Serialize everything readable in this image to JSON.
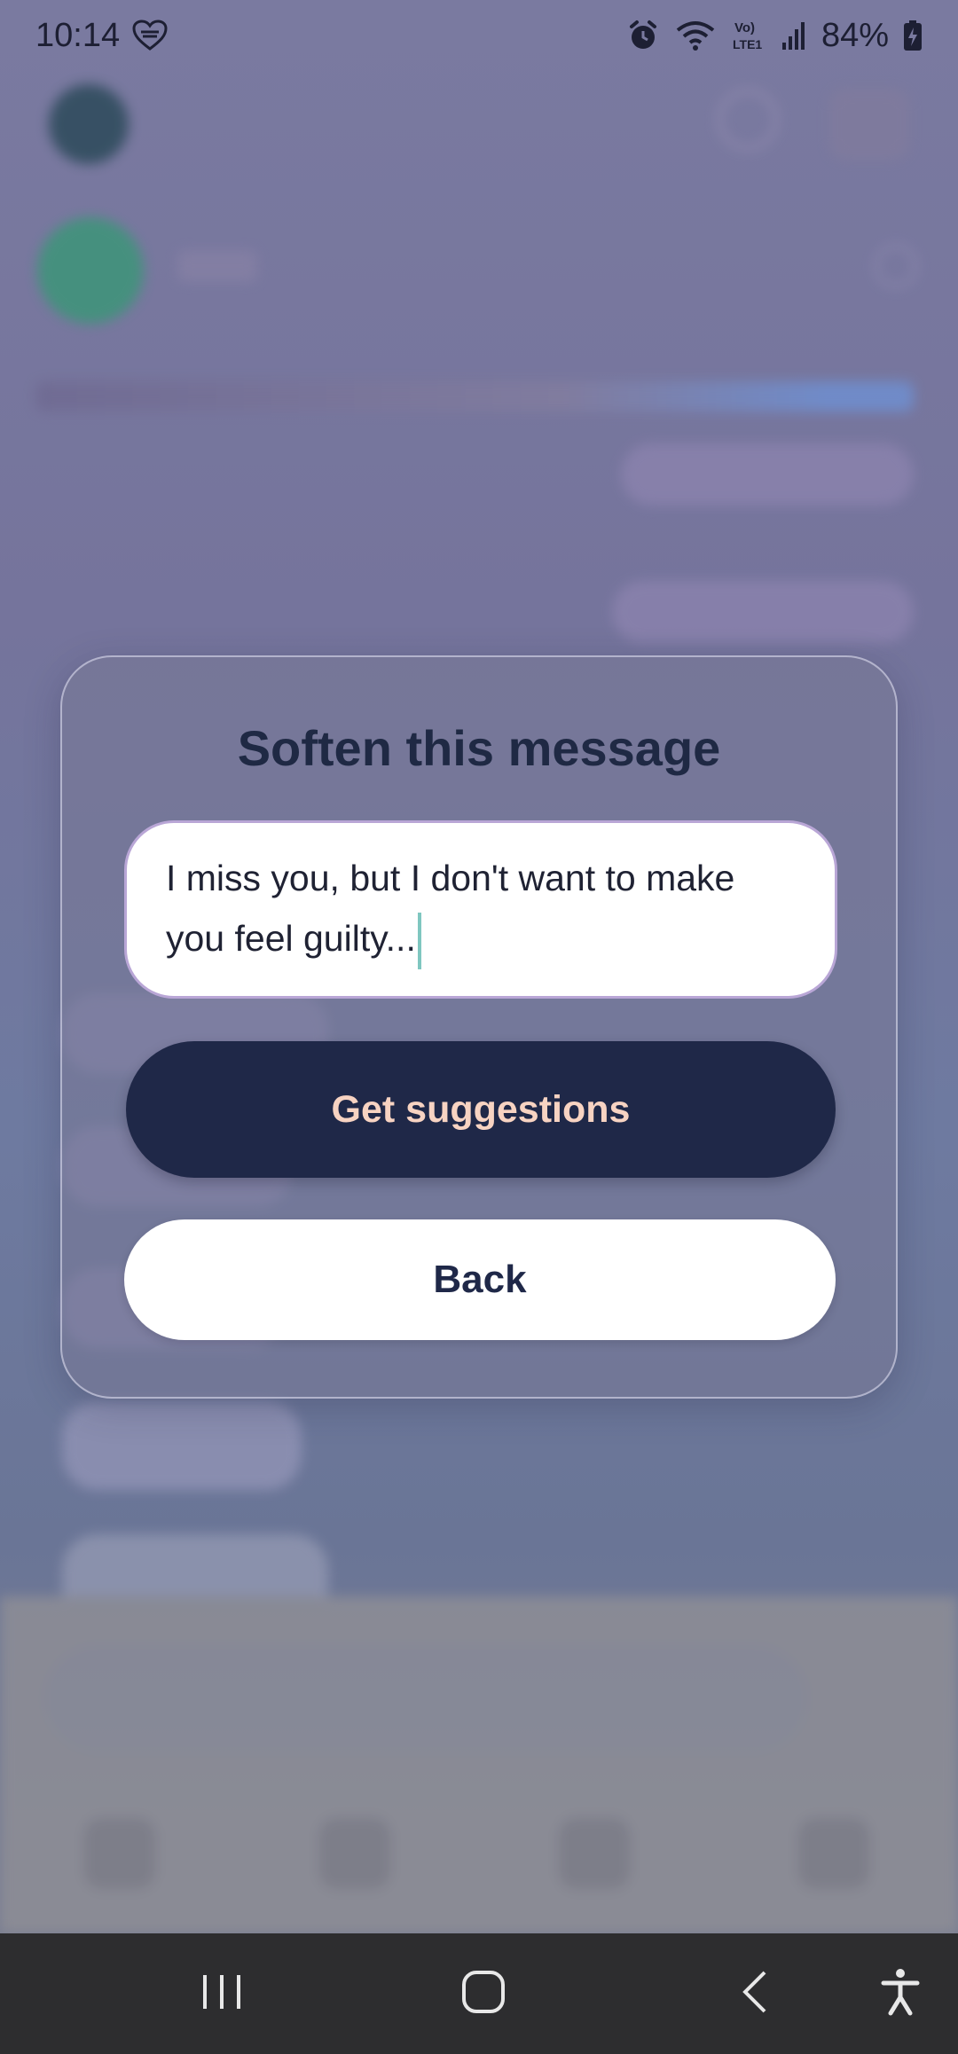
{
  "status_bar": {
    "time": "10:14",
    "left_icon": "heart-notification-icon",
    "right_icons": [
      "alarm-icon",
      "wifi-icon",
      "volte-lte-icon",
      "signal-icon"
    ],
    "volte_text": "Vo)\nLTE1",
    "battery_percent": "84%"
  },
  "dialog": {
    "title": "Soften this message",
    "message_value": "I miss you, but I don't want to make you feel guilty...",
    "primary_button": "Get suggestions",
    "secondary_button": "Back"
  },
  "colors": {
    "primary_button_bg": "#1f2848",
    "primary_button_text": "#f7d3c2",
    "title_text": "#1f2944",
    "caret": "#7fc7c0",
    "message_border": "#b9a6d6"
  },
  "system_nav": {
    "recents_icon": "recents-icon",
    "home_icon": "home-icon",
    "back_icon": "back-icon",
    "accessibility_icon": "accessibility-icon"
  }
}
